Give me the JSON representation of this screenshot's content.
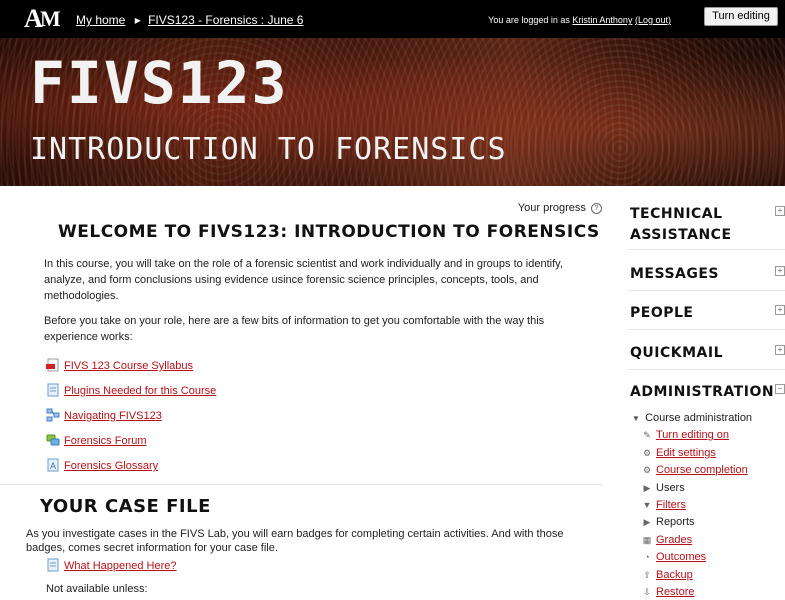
{
  "topbar": {
    "logo_a": "A",
    "logo_m": "M",
    "breadcrumb": [
      "My home",
      "FIVS123 - Forensics : June 6"
    ],
    "separator": "▸",
    "login_prefix": "You are logged in as",
    "user_name": "Kristin Anthony",
    "logout_label": "(Log out)",
    "edit_button_label": "Turn editing on"
  },
  "banner": {
    "title": "FIVS123",
    "subtitle": "INTRODUCTION TO FORENSICS"
  },
  "main": {
    "progress_label": "Your progress",
    "help_glyph": "?",
    "welcome_title": "WELCOME TO FIVS123: INTRODUCTION TO FORENSICS",
    "intro_paragraph": "In this course, you will take on the role of a forensic scientist and work individually and in groups to identify, analyze, and form conclusions using evidence usince forensic science principles, concepts, tools, and methodologies.",
    "before_paragraph": "Before you take on your role, here are a few bits of information to get you comfortable with the way this experience works:",
    "resources": [
      {
        "label": "FIVS 123 Course Syllabus",
        "icon": "pdf-icon"
      },
      {
        "label": "Plugins Needed for this Course",
        "icon": "page-icon"
      },
      {
        "label": "Navigating FIVS123",
        "icon": "diagram-icon"
      },
      {
        "label": "Forensics Forum",
        "icon": "forum-icon"
      },
      {
        "label": "Forensics Glossary",
        "icon": "glossary-icon"
      }
    ],
    "case_file_title": "YOUR CASE FILE",
    "case_file_paragraph": "As you investigate cases in the FIVS Lab, you will earn badges for completing certain activities. And with those badges, comes secret information for your case file.",
    "case_file_link": "What Happened Here?",
    "not_available": "Not available unless:"
  },
  "sidebar": {
    "blocks": [
      "TECHNICAL ASSISTANCE",
      "MESSAGES",
      "PEOPLE",
      "QUICKMAIL",
      "ADMINISTRATION"
    ],
    "collapse_glyph": "+",
    "expand_glyph": "−",
    "admin_root": "Course administration",
    "admin_items": [
      {
        "label": "Turn editing on",
        "icon": "pencil-icon",
        "link": true
      },
      {
        "label": "Edit settings",
        "icon": "gear-icon",
        "link": true
      },
      {
        "label": "Course completion",
        "icon": "gear-icon",
        "link": true
      },
      {
        "label": "Users",
        "icon": "caret-right-icon",
        "link": false
      },
      {
        "label": "Filters",
        "icon": "filter-icon",
        "link": true
      },
      {
        "label": "Reports",
        "icon": "caret-right-icon",
        "link": false
      },
      {
        "label": "Grades",
        "icon": "grades-icon",
        "link": true
      },
      {
        "label": "Outcomes",
        "icon": "pie-icon",
        "link": true
      },
      {
        "label": "Backup",
        "icon": "upload-icon",
        "link": true
      },
      {
        "label": "Restore",
        "icon": "download-icon",
        "link": true
      }
    ]
  },
  "colors": {
    "link": "#b5121b",
    "topbar": "#000000",
    "banner_dark": "#2a0c05"
  }
}
